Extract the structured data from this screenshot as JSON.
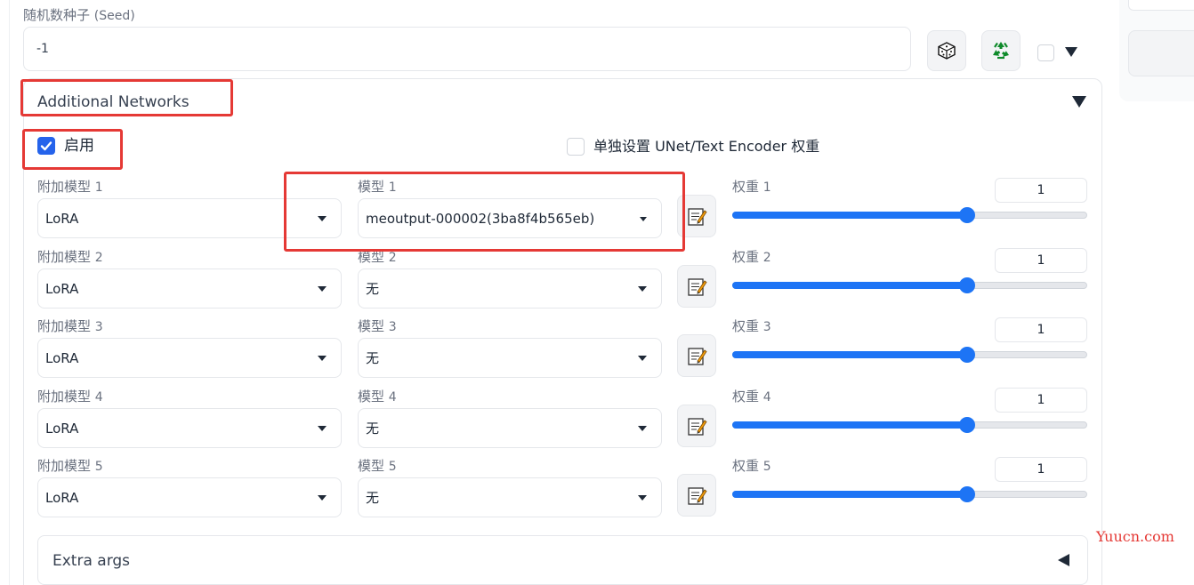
{
  "seed": {
    "label": "随机数种子",
    "label_suffix": "(Seed)",
    "value": "-1",
    "dice_icon": "dice-icon",
    "recycle_icon": "recycle-icon"
  },
  "additional_networks": {
    "title": "Additional Networks",
    "enable_label": "启用",
    "enabled": true,
    "separate_weights_label": "单独设置 UNet/Text Encoder 权重",
    "separate_weights_checked": false,
    "rows": [
      {
        "type_label": "附加模型",
        "index": "1",
        "type_value": "LoRA",
        "model_label": "模型",
        "model_value": "meoutput-000002(3ba8f4b565eb)",
        "weight_label": "权重",
        "weight_value": "1",
        "weight_fraction": 0.66
      },
      {
        "type_label": "附加模型",
        "index": "2",
        "type_value": "LoRA",
        "model_label": "模型",
        "model_value": "无",
        "weight_label": "权重",
        "weight_value": "1",
        "weight_fraction": 0.66
      },
      {
        "type_label": "附加模型",
        "index": "3",
        "type_value": "LoRA",
        "model_label": "模型",
        "model_value": "无",
        "weight_label": "权重",
        "weight_value": "1",
        "weight_fraction": 0.66
      },
      {
        "type_label": "附加模型",
        "index": "4",
        "type_value": "LoRA",
        "model_label": "模型",
        "model_value": "无",
        "weight_label": "权重",
        "weight_value": "1",
        "weight_fraction": 0.66
      },
      {
        "type_label": "附加模型",
        "index": "5",
        "type_value": "LoRA",
        "model_label": "模型",
        "model_value": "无",
        "weight_label": "权重",
        "weight_value": "1",
        "weight_fraction": 0.66
      }
    ],
    "extra_args_label": "Extra args"
  },
  "watermark": "Yuucn.com",
  "colors": {
    "accent": "#1d74f5",
    "highlight": "#e53935",
    "watermark": "#e53935"
  }
}
